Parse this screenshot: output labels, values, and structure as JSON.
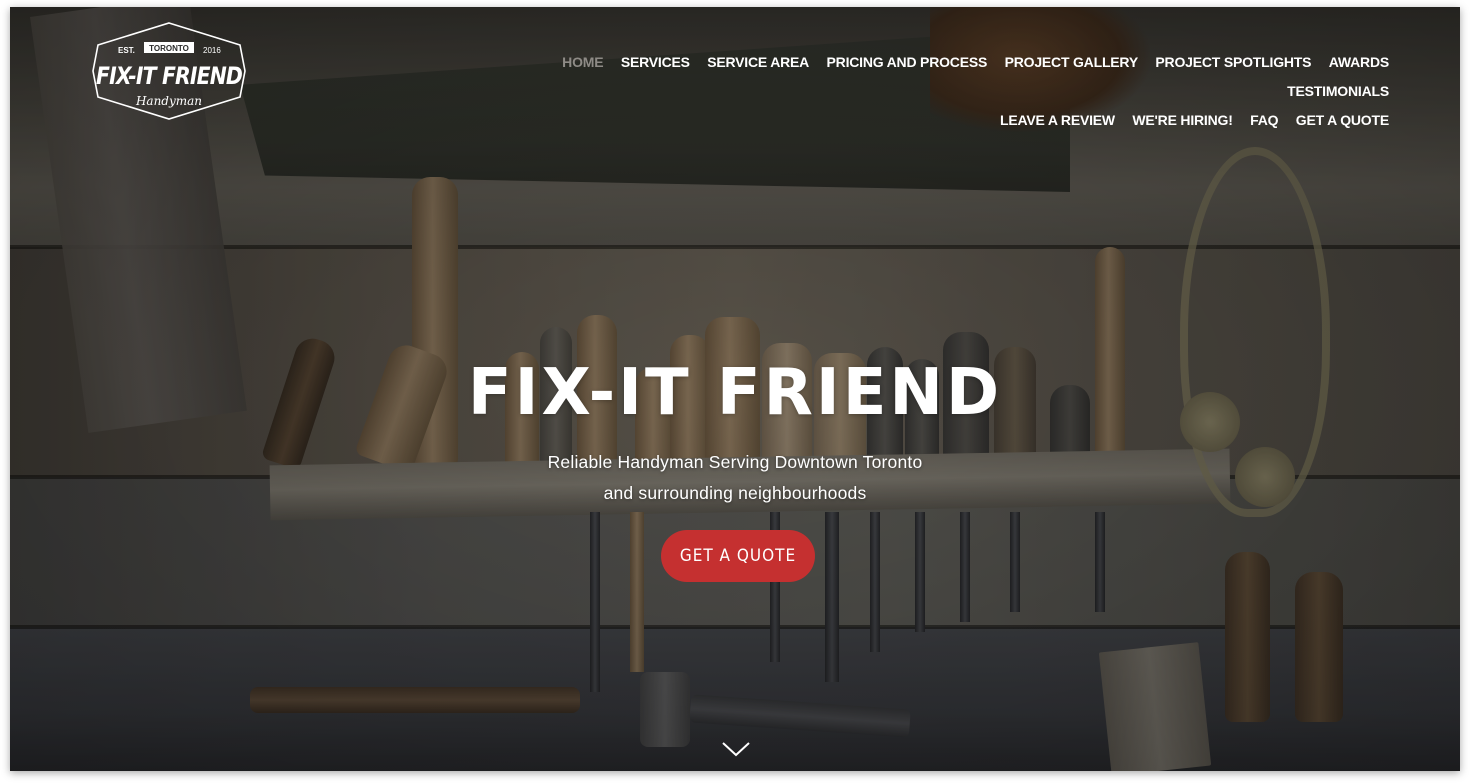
{
  "brand": {
    "logo": {
      "est_label": "EST.",
      "city_badge": "TORONTO",
      "year": "2016",
      "name": "FIX-IT FRIEND",
      "tagline": "Handyman"
    }
  },
  "nav": {
    "items": [
      {
        "label": "HOME",
        "active": true
      },
      {
        "label": "SERVICES",
        "active": false
      },
      {
        "label": "SERVICE AREA",
        "active": false
      },
      {
        "label": "PRICING AND PROCESS",
        "active": false
      },
      {
        "label": "PROJECT GALLERY",
        "active": false
      },
      {
        "label": "PROJECT SPOTLIGHTS",
        "active": false
      },
      {
        "label": "AWARDS",
        "active": false
      },
      {
        "label": "TESTIMONIALS",
        "active": false
      },
      {
        "label": "LEAVE A REVIEW",
        "active": false
      },
      {
        "label": "WE'RE HIRING!",
        "active": false
      },
      {
        "label": "FAQ",
        "active": false
      },
      {
        "label": "GET A QUOTE",
        "active": false
      }
    ]
  },
  "hero": {
    "title": "FIX-IT FRIEND",
    "subtitle_line1": "Reliable Handyman Serving Downtown Toronto",
    "subtitle_line2": "and surrounding neighbourhoods",
    "cta_label": "GET A QUOTE",
    "scroll_icon": "chevron-down-icon"
  },
  "colors": {
    "accent": "#c53030",
    "nav_active": "#8e8b86",
    "text": "#ffffff"
  }
}
